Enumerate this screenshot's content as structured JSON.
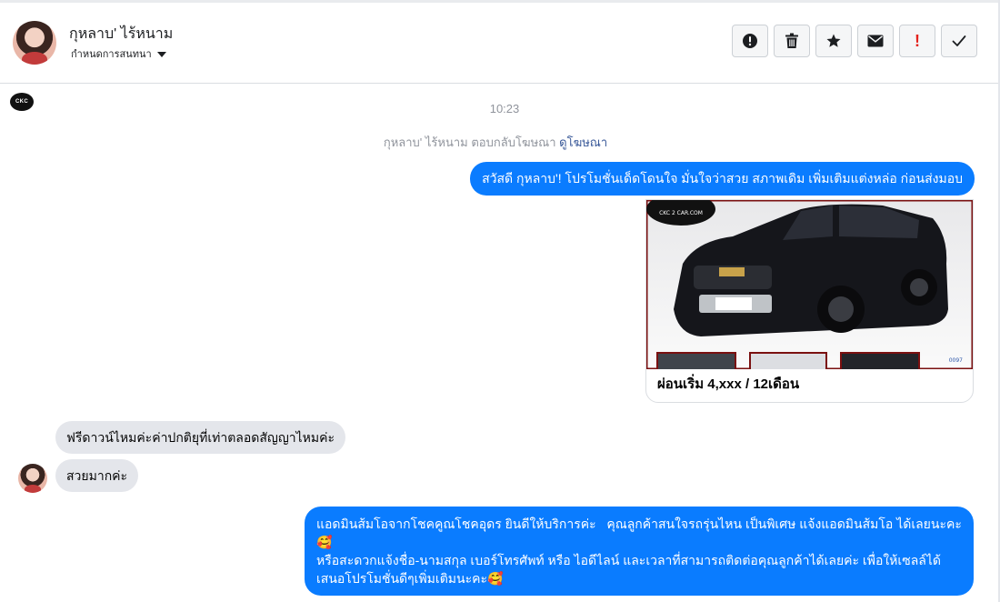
{
  "header": {
    "contact_name": "กุหลาบ' ไร้หนาม",
    "assign_label": "กำหนดการสนทนา",
    "toolbar": [
      {
        "name": "exclamation-circle-icon"
      },
      {
        "name": "trash-icon"
      },
      {
        "name": "star-icon"
      },
      {
        "name": "envelope-icon"
      },
      {
        "name": "red-exclamation-icon",
        "color": "#e4221c",
        "label": "!"
      },
      {
        "name": "checkmark-icon"
      }
    ]
  },
  "page": {
    "avatar_text": "CKC"
  },
  "thread": {
    "timestamp": "10:23",
    "system_text": "กุหลาบ' ไร้หนาม ตอบกลับโฆษณา",
    "system_link": "ดูโฆษณา",
    "messages": [
      {
        "from": "page",
        "text": "สวัสดี กุหลาบ'! โปรโมชั่นเด็ดโดนใจ มั่นใจว่าสวย สภาพเดิม เพิ่มเติมแต่งหล่อ ก่อนส่งมอบ"
      },
      {
        "from": "page",
        "type": "ad",
        "image_label": "CKC 2 CAR.COM",
        "image_code": "0097",
        "caption": "ผ่อนเริ่ม 4,xxx / 12เดือน"
      },
      {
        "from": "user",
        "text": "ฟรีดาวน์ไหมค่ะค่าปกติยุที่เท่าตลอดสัญญาไหมค่ะ"
      },
      {
        "from": "user",
        "text": "สวยมากค่ะ"
      },
      {
        "from": "page",
        "text": "แอดมินส้มโอจากโชคคูณโชคอุดร ยินดีให้บริการค่ะ   คุณลูกค้าสนใจรถรุ่นไหน เป็นพิเศษ แจ้งแอดมินส้มโอ ได้เลยนะคะ🥰\nหรือสะดวกแจ้งชื่อ-นามสกุล เบอร์โทรศัพท์ หรือ ไอดีไลน์ และเวลาที่สามารถติดต่อคุณลูกค้าได้เลยค่ะ เพื่อให้เซลล์ได้เสนอโปรโมชั่นดีๆเพิ่มเติมนะคะ🥰"
      }
    ]
  },
  "colors": {
    "outgoing_bubble": "#0a7cff",
    "incoming_bubble": "#e4e6eb",
    "link": "#385898",
    "muted": "#90949c"
  }
}
